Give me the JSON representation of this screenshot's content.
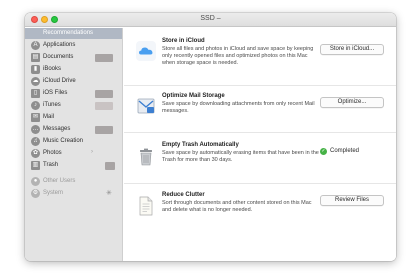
{
  "window": {
    "title": "SSD –"
  },
  "sidebar": {
    "selected_label": "Recommendations",
    "items": [
      {
        "label": "Applications",
        "icon": "applications-icon"
      },
      {
        "label": "Documents",
        "icon": "documents-icon"
      },
      {
        "label": "iBooks",
        "icon": "ibooks-icon"
      },
      {
        "label": "iCloud Drive",
        "icon": "icloud-drive-icon"
      },
      {
        "label": "iOS Files",
        "icon": "ios-files-icon"
      },
      {
        "label": "iTunes",
        "icon": "itunes-icon"
      },
      {
        "label": "Mail",
        "icon": "mail-icon"
      },
      {
        "label": "Messages",
        "icon": "messages-icon"
      },
      {
        "label": "Music Creation",
        "icon": "music-creation-icon"
      },
      {
        "label": "Photos",
        "icon": "photos-icon"
      },
      {
        "label": "Trash",
        "icon": "trash-icon"
      },
      {
        "label": "Other Users",
        "icon": "other-users-icon"
      },
      {
        "label": "System",
        "icon": "system-icon"
      }
    ]
  },
  "recommendations": [
    {
      "title": "Store in iCloud",
      "description": "Store all files and photos in iCloud and save space by keeping only recently opened files and optimized photos on this Mac when storage space is needed.",
      "button": "Store in iCloud...",
      "icon": "icloud-icon"
    },
    {
      "title": "Optimize Mail Storage",
      "description": "Save space by downloading attachments from only recent Mail messages.",
      "button": "Optimize...",
      "icon": "mail-storage-icon"
    },
    {
      "title": "Empty Trash Automatically",
      "description": "Save space by automatically erasing items that have been in the Trash for more than 30 days.",
      "status": "Completed",
      "icon": "trash-icon"
    },
    {
      "title": "Reduce Clutter",
      "description": "Sort through documents and other content stored on this Mac and delete what is no longer needed.",
      "button": "Review Files",
      "icon": "document-icon"
    }
  ],
  "colors": {
    "selection": "#b0b8c4",
    "completed": "#45b246",
    "close": "#fc5f57",
    "minimize": "#fdbc2e",
    "maximize": "#28c840"
  }
}
